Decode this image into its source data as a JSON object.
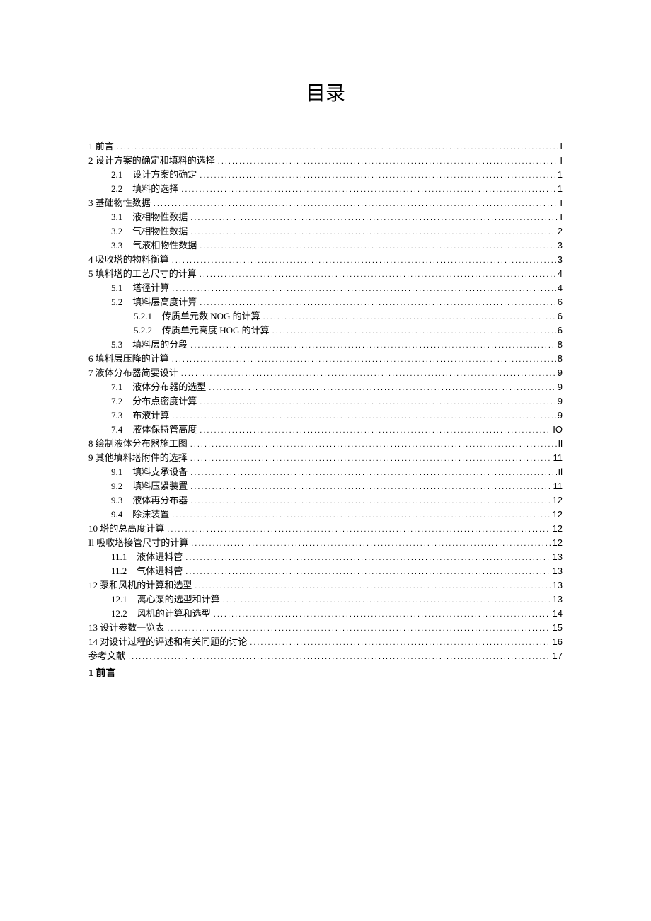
{
  "title": "目录",
  "section_heading": "1 前言",
  "toc": [
    {
      "indent": 0,
      "num": "1",
      "label": "前言",
      "page": "I",
      "combineNum": true
    },
    {
      "indent": 0,
      "num": "2",
      "label": "设计方案的确定和填料的选择",
      "page": "I",
      "combineNum": true
    },
    {
      "indent": 1,
      "num": "2.1",
      "label": "设计方案的确定",
      "page": "1"
    },
    {
      "indent": 1,
      "num": "2.2",
      "label": "填料的选择",
      "page": "1"
    },
    {
      "indent": 0,
      "num": "3",
      "label": "基础物性数据",
      "page": "I",
      "combineNum": true
    },
    {
      "indent": 1,
      "num": "3.1",
      "label": "液相物性数据",
      "page": "I"
    },
    {
      "indent": 1,
      "num": "3.2",
      "label": "气相物性数据",
      "page": "2"
    },
    {
      "indent": 1,
      "num": "3.3",
      "label": "气液相物性数据",
      "page": "3"
    },
    {
      "indent": 0,
      "num": "4",
      "label": "吸收塔的物料衡算",
      "page": "3",
      "combineNum": true
    },
    {
      "indent": 0,
      "num": "5",
      "label": "填料塔的工艺尺寸的计算",
      "page": "4",
      "combineNum": true
    },
    {
      "indent": 1,
      "num": "5.1",
      "label": "塔径计算",
      "page": "4"
    },
    {
      "indent": 1,
      "num": "5.2",
      "label": "填料层高度计算",
      "page": "6"
    },
    {
      "indent": 2,
      "num": "5.2.1",
      "label": "传质单元数 NOG 的计算",
      "page": "6"
    },
    {
      "indent": 2,
      "num": "5.2.2",
      "label": "传质单元高度 HOG 的计算",
      "page": "6"
    },
    {
      "indent": 1,
      "num": "5.3",
      "label": "填料层的分段",
      "page": "8"
    },
    {
      "indent": 0,
      "num": "6",
      "label": "填料层压降的计算",
      "page": "8",
      "combineNum": true
    },
    {
      "indent": 0,
      "num": "7",
      "label": "液体分布器简要设计",
      "page": "9",
      "combineNum": true
    },
    {
      "indent": 1,
      "num": "7.1",
      "label": "液体分布器的选型",
      "page": "9"
    },
    {
      "indent": 1,
      "num": "7.2",
      "label": "分布点密度计算",
      "page": "9"
    },
    {
      "indent": 1,
      "num": "7.3",
      "label": "布液计算",
      "page": "9"
    },
    {
      "indent": 1,
      "num": "7.4",
      "label": "液体保持管高度",
      "page": "IO"
    },
    {
      "indent": 0,
      "num": "8",
      "label": "绘制液体分布器施工图",
      "page": "Il",
      "combineNum": true
    },
    {
      "indent": 0,
      "num": "9",
      "label": "其他填料塔附件的选择",
      "page": "11",
      "combineNum": true
    },
    {
      "indent": 1,
      "num": "9.1",
      "label": "填料支承设备",
      "page": "Il"
    },
    {
      "indent": 1,
      "num": "9.2",
      "label": "填料压紧装置",
      "page": "11"
    },
    {
      "indent": 1,
      "num": "9.3",
      "label": "液体再分布器",
      "page": "12"
    },
    {
      "indent": 1,
      "num": "9.4",
      "label": "除沫装置",
      "page": "12"
    },
    {
      "indent": 0,
      "num": "10",
      "label": "塔的总高度计算",
      "page": "12",
      "combineNum": true
    },
    {
      "indent": 0,
      "num": "Il",
      "label": "吸收塔接管尺寸的计算",
      "page": "12",
      "combineNum": true
    },
    {
      "indent": 1,
      "num": "11.1",
      "label": "液体进料管",
      "page": "13"
    },
    {
      "indent": 1,
      "num": "11.2",
      "label": "气体进料管",
      "page": "13"
    },
    {
      "indent": 0,
      "num": "12",
      "label": "泵和风机的计算和选型",
      "page": "13",
      "combineNum": true
    },
    {
      "indent": 1,
      "num": "12.1",
      "label": "离心泵的选型和计算",
      "page": "13"
    },
    {
      "indent": 1,
      "num": "12.2",
      "label": "风机的计算和选型",
      "page": "14"
    },
    {
      "indent": 0,
      "num": "13",
      "label": "设计参数一览表",
      "page": "15",
      "combineNum": true
    },
    {
      "indent": 0,
      "num": "14",
      "label": "对设计过程的评述和有关问题的讨论",
      "page": "16",
      "combineNum": true
    },
    {
      "indent": 0,
      "num": "",
      "label": "参考文献",
      "page": "17",
      "combineNum": true
    }
  ]
}
